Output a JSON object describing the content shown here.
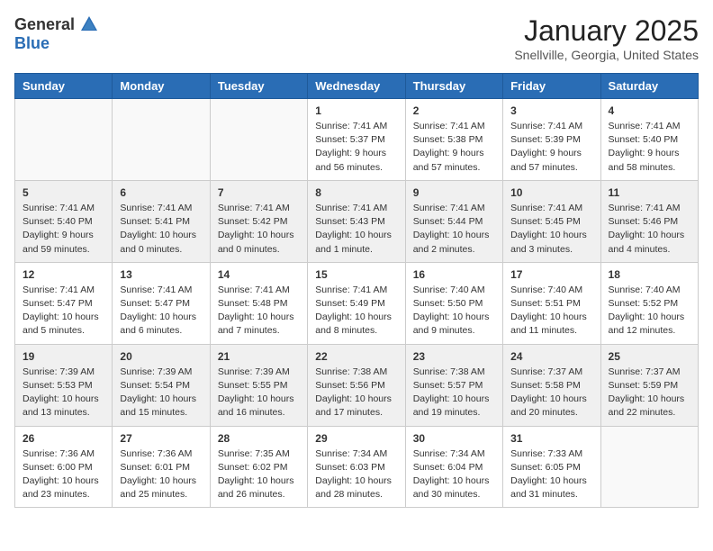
{
  "logo": {
    "general": "General",
    "blue": "Blue"
  },
  "header": {
    "month": "January 2025",
    "location": "Snellville, Georgia, United States"
  },
  "weekdays": [
    "Sunday",
    "Monday",
    "Tuesday",
    "Wednesday",
    "Thursday",
    "Friday",
    "Saturday"
  ],
  "weeks": [
    [
      {
        "day": "",
        "info": ""
      },
      {
        "day": "",
        "info": ""
      },
      {
        "day": "",
        "info": ""
      },
      {
        "day": "1",
        "info": "Sunrise: 7:41 AM\nSunset: 5:37 PM\nDaylight: 9 hours\nand 56 minutes."
      },
      {
        "day": "2",
        "info": "Sunrise: 7:41 AM\nSunset: 5:38 PM\nDaylight: 9 hours\nand 57 minutes."
      },
      {
        "day": "3",
        "info": "Sunrise: 7:41 AM\nSunset: 5:39 PM\nDaylight: 9 hours\nand 57 minutes."
      },
      {
        "day": "4",
        "info": "Sunrise: 7:41 AM\nSunset: 5:40 PM\nDaylight: 9 hours\nand 58 minutes."
      }
    ],
    [
      {
        "day": "5",
        "info": "Sunrise: 7:41 AM\nSunset: 5:40 PM\nDaylight: 9 hours\nand 59 minutes."
      },
      {
        "day": "6",
        "info": "Sunrise: 7:41 AM\nSunset: 5:41 PM\nDaylight: 10 hours\nand 0 minutes."
      },
      {
        "day": "7",
        "info": "Sunrise: 7:41 AM\nSunset: 5:42 PM\nDaylight: 10 hours\nand 0 minutes."
      },
      {
        "day": "8",
        "info": "Sunrise: 7:41 AM\nSunset: 5:43 PM\nDaylight: 10 hours\nand 1 minute."
      },
      {
        "day": "9",
        "info": "Sunrise: 7:41 AM\nSunset: 5:44 PM\nDaylight: 10 hours\nand 2 minutes."
      },
      {
        "day": "10",
        "info": "Sunrise: 7:41 AM\nSunset: 5:45 PM\nDaylight: 10 hours\nand 3 minutes."
      },
      {
        "day": "11",
        "info": "Sunrise: 7:41 AM\nSunset: 5:46 PM\nDaylight: 10 hours\nand 4 minutes."
      }
    ],
    [
      {
        "day": "12",
        "info": "Sunrise: 7:41 AM\nSunset: 5:47 PM\nDaylight: 10 hours\nand 5 minutes."
      },
      {
        "day": "13",
        "info": "Sunrise: 7:41 AM\nSunset: 5:47 PM\nDaylight: 10 hours\nand 6 minutes."
      },
      {
        "day": "14",
        "info": "Sunrise: 7:41 AM\nSunset: 5:48 PM\nDaylight: 10 hours\nand 7 minutes."
      },
      {
        "day": "15",
        "info": "Sunrise: 7:41 AM\nSunset: 5:49 PM\nDaylight: 10 hours\nand 8 minutes."
      },
      {
        "day": "16",
        "info": "Sunrise: 7:40 AM\nSunset: 5:50 PM\nDaylight: 10 hours\nand 9 minutes."
      },
      {
        "day": "17",
        "info": "Sunrise: 7:40 AM\nSunset: 5:51 PM\nDaylight: 10 hours\nand 11 minutes."
      },
      {
        "day": "18",
        "info": "Sunrise: 7:40 AM\nSunset: 5:52 PM\nDaylight: 10 hours\nand 12 minutes."
      }
    ],
    [
      {
        "day": "19",
        "info": "Sunrise: 7:39 AM\nSunset: 5:53 PM\nDaylight: 10 hours\nand 13 minutes."
      },
      {
        "day": "20",
        "info": "Sunrise: 7:39 AM\nSunset: 5:54 PM\nDaylight: 10 hours\nand 15 minutes."
      },
      {
        "day": "21",
        "info": "Sunrise: 7:39 AM\nSunset: 5:55 PM\nDaylight: 10 hours\nand 16 minutes."
      },
      {
        "day": "22",
        "info": "Sunrise: 7:38 AM\nSunset: 5:56 PM\nDaylight: 10 hours\nand 17 minutes."
      },
      {
        "day": "23",
        "info": "Sunrise: 7:38 AM\nSunset: 5:57 PM\nDaylight: 10 hours\nand 19 minutes."
      },
      {
        "day": "24",
        "info": "Sunrise: 7:37 AM\nSunset: 5:58 PM\nDaylight: 10 hours\nand 20 minutes."
      },
      {
        "day": "25",
        "info": "Sunrise: 7:37 AM\nSunset: 5:59 PM\nDaylight: 10 hours\nand 22 minutes."
      }
    ],
    [
      {
        "day": "26",
        "info": "Sunrise: 7:36 AM\nSunset: 6:00 PM\nDaylight: 10 hours\nand 23 minutes."
      },
      {
        "day": "27",
        "info": "Sunrise: 7:36 AM\nSunset: 6:01 PM\nDaylight: 10 hours\nand 25 minutes."
      },
      {
        "day": "28",
        "info": "Sunrise: 7:35 AM\nSunset: 6:02 PM\nDaylight: 10 hours\nand 26 minutes."
      },
      {
        "day": "29",
        "info": "Sunrise: 7:34 AM\nSunset: 6:03 PM\nDaylight: 10 hours\nand 28 minutes."
      },
      {
        "day": "30",
        "info": "Sunrise: 7:34 AM\nSunset: 6:04 PM\nDaylight: 10 hours\nand 30 minutes."
      },
      {
        "day": "31",
        "info": "Sunrise: 7:33 AM\nSunset: 6:05 PM\nDaylight: 10 hours\nand 31 minutes."
      },
      {
        "day": "",
        "info": ""
      }
    ]
  ]
}
